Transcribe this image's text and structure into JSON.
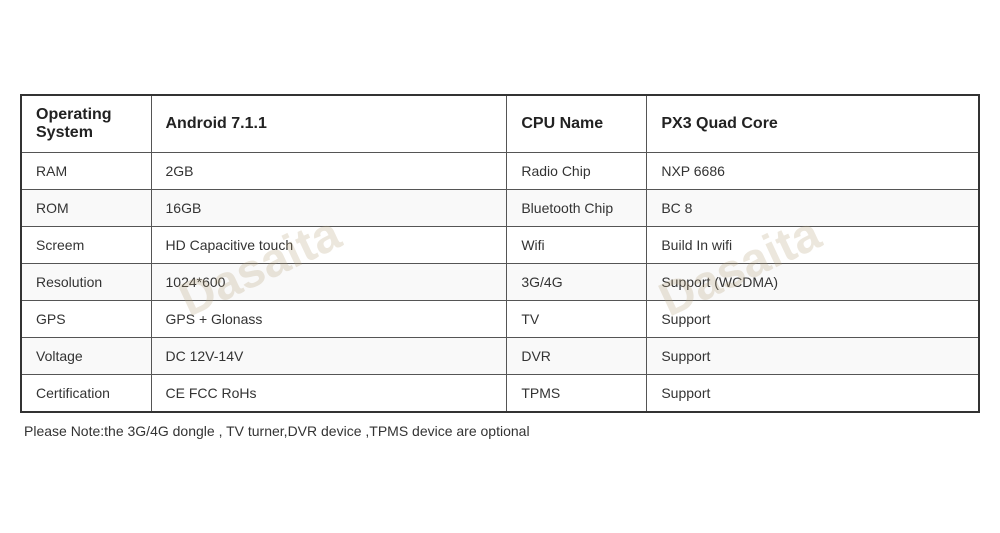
{
  "table": {
    "header": {
      "col1_label": "Operating System",
      "col1_value": "Android 7.1.1",
      "col2_label": "CPU Name",
      "col2_value": "PX3 Quad Core"
    },
    "rows": [
      {
        "col1_label": "RAM",
        "col1_value": "2GB",
        "col2_label": "Radio Chip",
        "col2_value": "NXP 6686"
      },
      {
        "col1_label": "ROM",
        "col1_value": "16GB",
        "col2_label": "Bluetooth Chip",
        "col2_value": "BC 8"
      },
      {
        "col1_label": "Screem",
        "col1_value": "HD Capacitive touch",
        "col2_label": "Wifi",
        "col2_value": "Build In wifi"
      },
      {
        "col1_label": "Resolution",
        "col1_value": "1024*600",
        "col2_label": "3G/4G",
        "col2_value": "Support (WCDMA)"
      },
      {
        "col1_label": "GPS",
        "col1_value": "GPS + Glonass",
        "col2_label": "TV",
        "col2_value": "Support"
      },
      {
        "col1_label": "Voltage",
        "col1_value": "DC 12V-14V",
        "col2_label": "DVR",
        "col2_value": "Support"
      },
      {
        "col1_label": "Certification",
        "col1_value": "CE FCC RoHs",
        "col2_label": "TPMS",
        "col2_value": "Support"
      }
    ]
  },
  "note": "Please Note:the 3G/4G dongle , TV turner,DVR device ,TPMS device are optional"
}
